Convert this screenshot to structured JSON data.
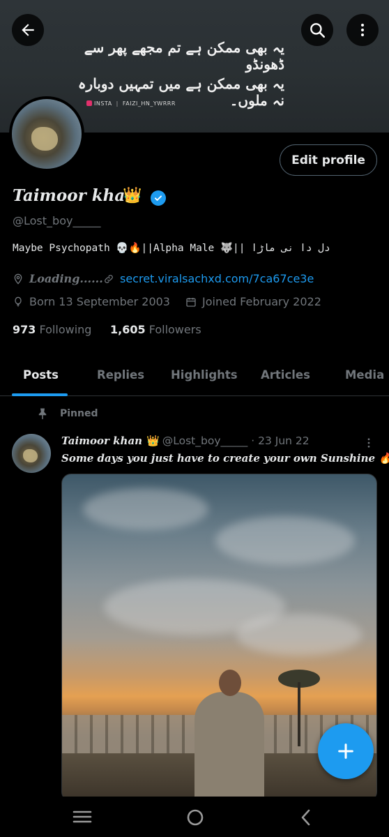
{
  "banner": {
    "urdu_line_1": "یہ بھی ممکن ہے تم مجھے پھر سے ڈھونڈو",
    "urdu_line_2": "یہ بھی ممکن ہے میں تمہیں دوبارہ نہ ملوں۔",
    "insta_label": "INSTA",
    "insta_handle": "FAIZI_HN_YWRRR"
  },
  "header": {
    "back_icon": "arrow-left-icon",
    "search_icon": "search-icon",
    "more_icon": "more-vertical-icon"
  },
  "profile": {
    "name": "Taimoor khan",
    "name_emoji": "👑",
    "handle": "@Lost_boy_____",
    "edit_label": "Edit profile",
    "bio": "Maybe Psychopath 💀🔥||Alpha Male 🐺|| دل دا نی ماڑا",
    "location": "Loading......",
    "link": "secret.viralsachxd.com/7ca67ce3e",
    "born": "Born 13 September 2003",
    "joined": "Joined February 2022",
    "following_count": "973",
    "following_label": "Following",
    "followers_count": "1,605",
    "followers_label": "Followers"
  },
  "tabs": [
    {
      "label": "Posts",
      "active": true
    },
    {
      "label": "Replies"
    },
    {
      "label": "Highlights"
    },
    {
      "label": "Articles"
    },
    {
      "label": "Media"
    }
  ],
  "post": {
    "pinned_label": "Pinned",
    "author": "Taimoor khan",
    "author_emoji": "👑",
    "handle": "@Lost_boy_____",
    "date": "· 23 Jun 22",
    "text": "Some days you just have to create your own Sunshine 🔥🖤"
  },
  "colors": {
    "accent": "#1d9bf0",
    "background": "#000000",
    "text_primary": "#e7e9ea",
    "text_secondary": "#71767b"
  }
}
